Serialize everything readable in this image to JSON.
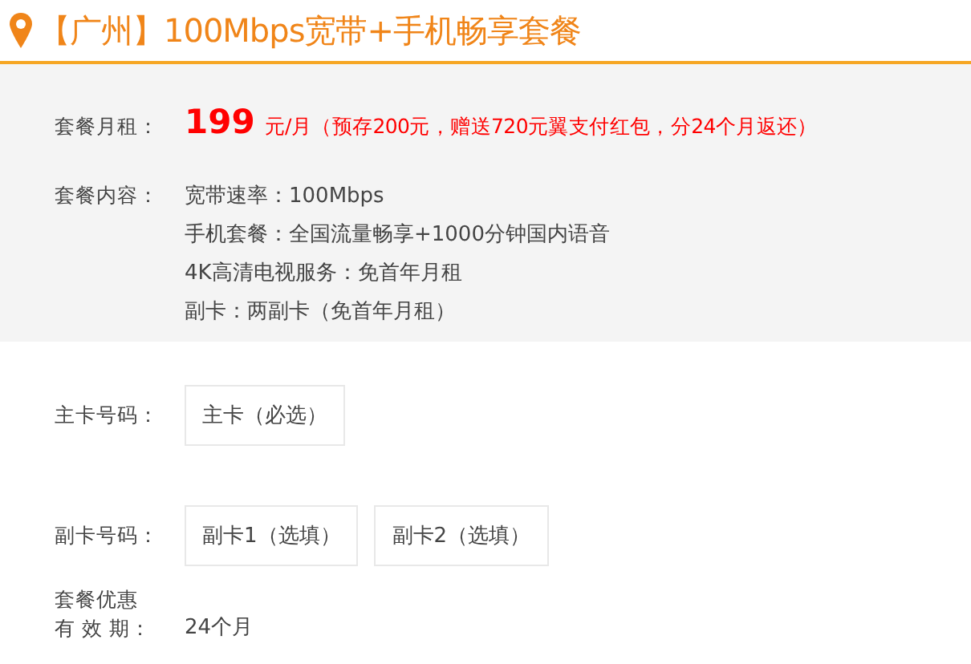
{
  "title": "【广州】100Mbps宽带+手机畅享套餐",
  "price": {
    "label": "套餐月租：",
    "amount": "199",
    "note": "元/月（预存200元，赠送720元翼支付红包，分24个月返还）"
  },
  "contents": {
    "label": "套餐内容：",
    "items": [
      "宽带速率：100Mbps",
      "手机套餐：全国流量畅享+1000分钟国内语音",
      "4K高清电视服务：免首年月租",
      "副卡：两副卡（免首年月租）"
    ]
  },
  "main_card": {
    "label": "主卡号码：",
    "options": [
      "主卡（必选）"
    ]
  },
  "sub_cards": {
    "label": "副卡号码：",
    "options": [
      "副卡1（选填）",
      "副卡2（选填）"
    ]
  },
  "validity": {
    "label_lines": [
      "套餐优惠",
      "有 效 期："
    ],
    "value": "24个月"
  }
}
